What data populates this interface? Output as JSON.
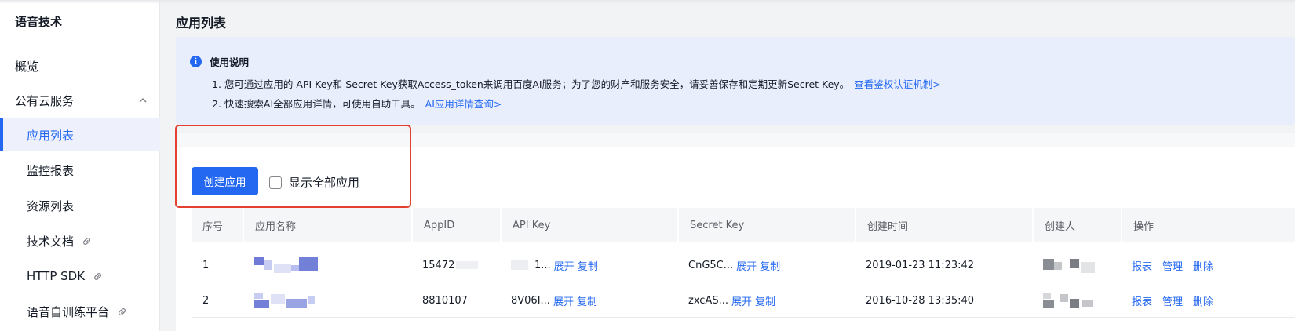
{
  "sidebar": {
    "title": "语音技术",
    "items": [
      {
        "label": "概览"
      },
      {
        "label": "公有云服务"
      },
      {
        "label": "应用列表"
      },
      {
        "label": "监控报表"
      },
      {
        "label": "资源列表"
      },
      {
        "label": "技术文档"
      },
      {
        "label": "HTTP SDK"
      },
      {
        "label": "语音自训练平台"
      }
    ]
  },
  "main": {
    "page_title": "应用列表",
    "notice": {
      "title": "使用说明",
      "line1_text": "1. 您可通过应用的 API Key和 Secret Key获取Access_token来调用百度AI服务；为了您的财产和服务安全，请妥善保存和定期更新Secret Key。",
      "line1_link": "查看鉴权认证机制>",
      "line2_text": "2. 快速搜索AI全部应用详情，可使用自助工具。",
      "line2_link": "AI应用详情查询>"
    },
    "create_button": "创建应用",
    "show_all_label": "显示全部应用",
    "table": {
      "headers": [
        "序号",
        "应用名称",
        "AppID",
        "API Key",
        "Secret Key",
        "创建时间",
        "创建人",
        "操作"
      ],
      "rows": [
        {
          "index": "1",
          "appid": "15472",
          "api_key": "1...",
          "secret_key": "CnG5C...",
          "created": "2019-01-23 11:23:42"
        },
        {
          "index": "2",
          "appid": "8810107",
          "api_key": "8V06I...",
          "secret_key": "zxcAS...",
          "created": "2016-10-28 13:35:40"
        }
      ],
      "expand": "展开",
      "copy": "复制",
      "op_report": "报表",
      "op_manage": "管理",
      "op_delete": "删除"
    }
  },
  "colors": {
    "accent": "#2468f2",
    "highlight": "#e4402f",
    "notice_bg": "#e8eefc"
  },
  "icons": [
    "info-icon",
    "chevron-up-icon",
    "link-icon"
  ]
}
